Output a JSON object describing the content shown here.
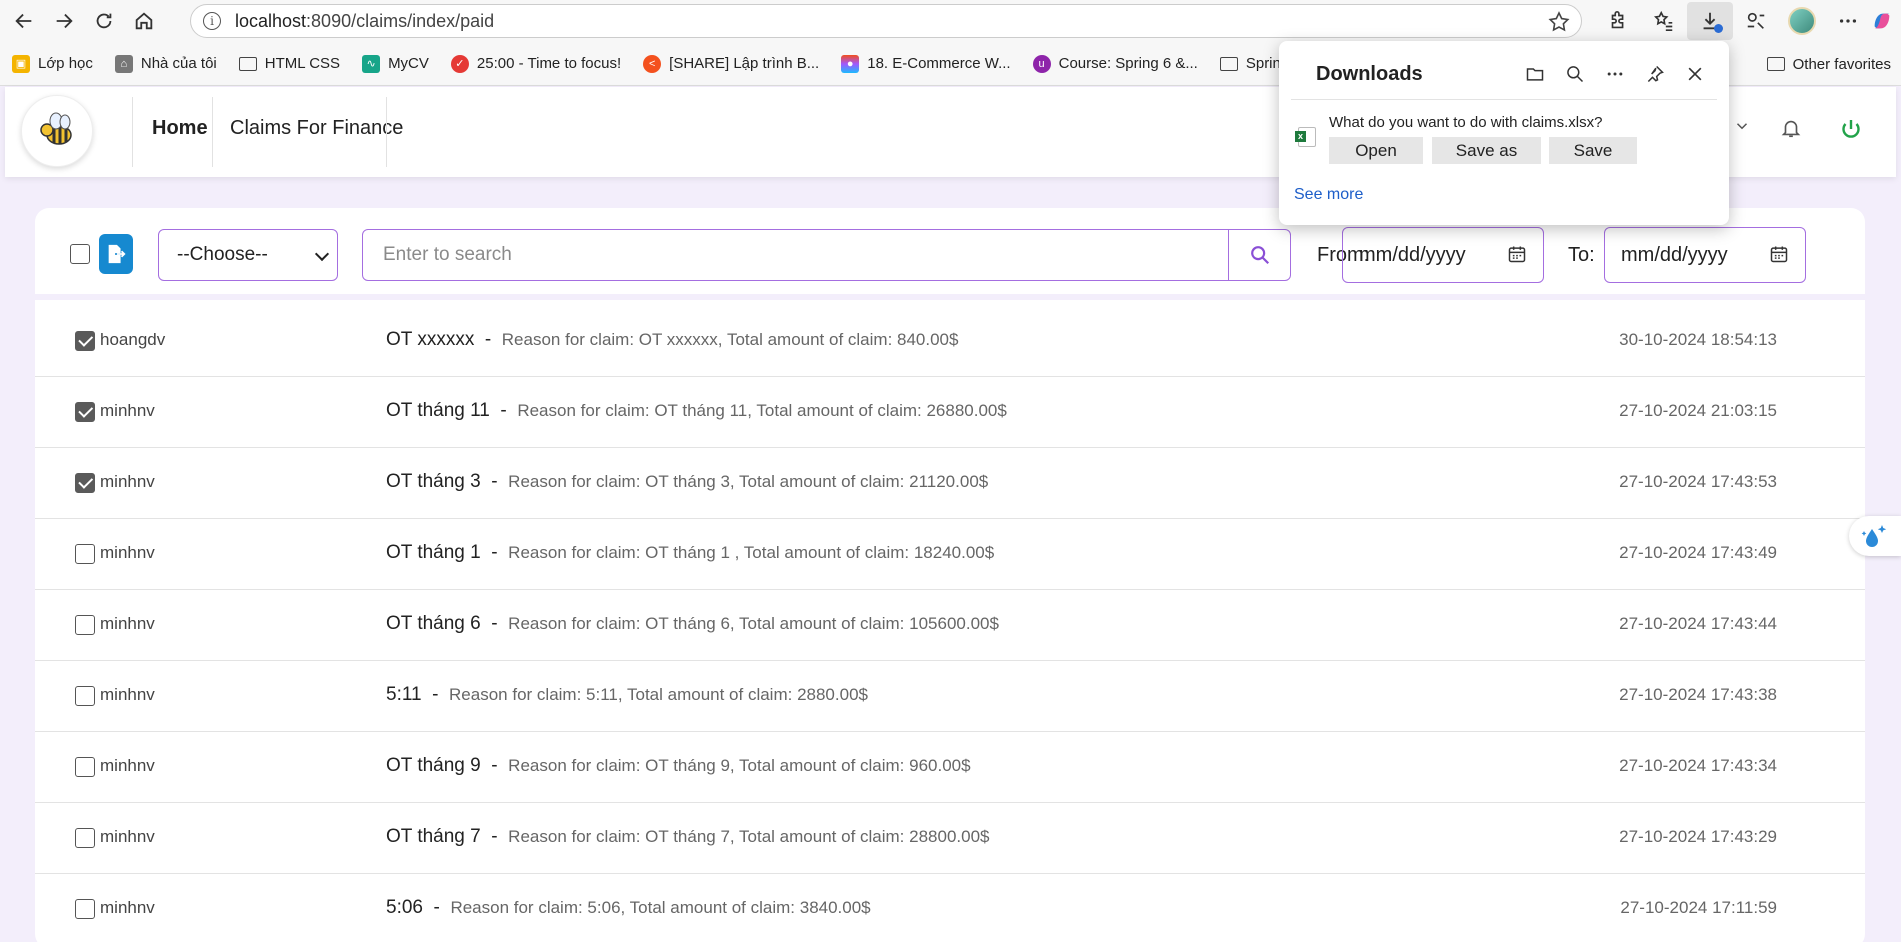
{
  "browser": {
    "url_host": "localhost",
    "url_path": ":8090/claims/index/paid",
    "bookmarks": [
      {
        "label": "Lớp học",
        "icon": "classroom-icon",
        "color": "#f4b400"
      },
      {
        "label": "Nhà của tôi",
        "icon": "home-page-icon",
        "color": "#777777"
      },
      {
        "label": "HTML CSS",
        "icon": "folder-icon",
        "color": ""
      },
      {
        "label": "MyCV",
        "icon": "mycv-icon",
        "color": "#17a589"
      },
      {
        "label": "25:00 - Time to focus!",
        "icon": "pomodoro-icon",
        "color": "#e53935"
      },
      {
        "label": "[SHARE] Lập trình B...",
        "icon": "share-icon",
        "color": "#f4511e"
      },
      {
        "label": "18. E-Commerce W...",
        "icon": "figma-icon",
        "color": "#a259ff"
      },
      {
        "label": "Course: Spring 6 &...",
        "icon": "course-icon",
        "color": "#8e24aa"
      },
      {
        "label": "Spring",
        "icon": "folder-icon",
        "color": ""
      }
    ],
    "other_favorites": "Other favorites"
  },
  "header": {
    "nav": [
      {
        "label": "Home",
        "active": true
      },
      {
        "label": "Claims For Finance",
        "active": false
      }
    ]
  },
  "filters": {
    "select_value": "--Choose--",
    "search_placeholder": "Enter to search",
    "from_label": "From:",
    "from_value": "mm/dd/yyyy",
    "to_label": "To:",
    "to_value": "mm/dd/yyyy"
  },
  "claims": [
    {
      "checked": true,
      "user": "hoangdv",
      "title": "OT xxxxxx",
      "reason": "Reason for claim: OT xxxxxx, Total amount of claim: 840.00$",
      "date": "30-10-2024 18:54:13"
    },
    {
      "checked": true,
      "user": "minhnv",
      "title": "OT tháng 11",
      "reason": "Reason for claim: OT tháng 11, Total amount of claim: 26880.00$",
      "date": "27-10-2024 21:03:15"
    },
    {
      "checked": true,
      "user": "minhnv",
      "title": "OT tháng 3",
      "reason": "Reason for claim: OT tháng 3, Total amount of claim: 21120.00$",
      "date": "27-10-2024 17:43:53"
    },
    {
      "checked": false,
      "user": "minhnv",
      "title": "OT tháng 1",
      "reason": "Reason for claim: OT tháng 1 , Total amount of claim: 18240.00$",
      "date": "27-10-2024 17:43:49"
    },
    {
      "checked": false,
      "user": "minhnv",
      "title": "OT tháng 6",
      "reason": "Reason for claim: OT tháng 6, Total amount of claim: 105600.00$",
      "date": "27-10-2024 17:43:44"
    },
    {
      "checked": false,
      "user": "minhnv",
      "title": "5:11",
      "reason": "Reason for claim: 5:11, Total amount of claim: 2880.00$",
      "date": "27-10-2024 17:43:38"
    },
    {
      "checked": false,
      "user": "minhnv",
      "title": "OT tháng 9",
      "reason": "Reason for claim: OT tháng 9, Total amount of claim: 960.00$",
      "date": "27-10-2024 17:43:34"
    },
    {
      "checked": false,
      "user": "minhnv",
      "title": "OT tháng 7",
      "reason": "Reason for claim: OT tháng 7, Total amount of claim: 28800.00$",
      "date": "27-10-2024 17:43:29"
    },
    {
      "checked": false,
      "user": "minhnv",
      "title": "5:06",
      "reason": "Reason for claim: 5:06, Total amount of claim: 3840.00$",
      "date": "27-10-2024 17:11:59"
    }
  ],
  "downloads": {
    "title": "Downloads",
    "question": "What do you want to do with claims.xlsx?",
    "open_label": "Open",
    "save_as_label": "Save as",
    "save_label": "Save",
    "see_more": "See more"
  },
  "colors": {
    "accent": "#a46ee0",
    "export_button": "#1689d0",
    "power": "#22a34a",
    "page_bg": "#f3eefb"
  }
}
